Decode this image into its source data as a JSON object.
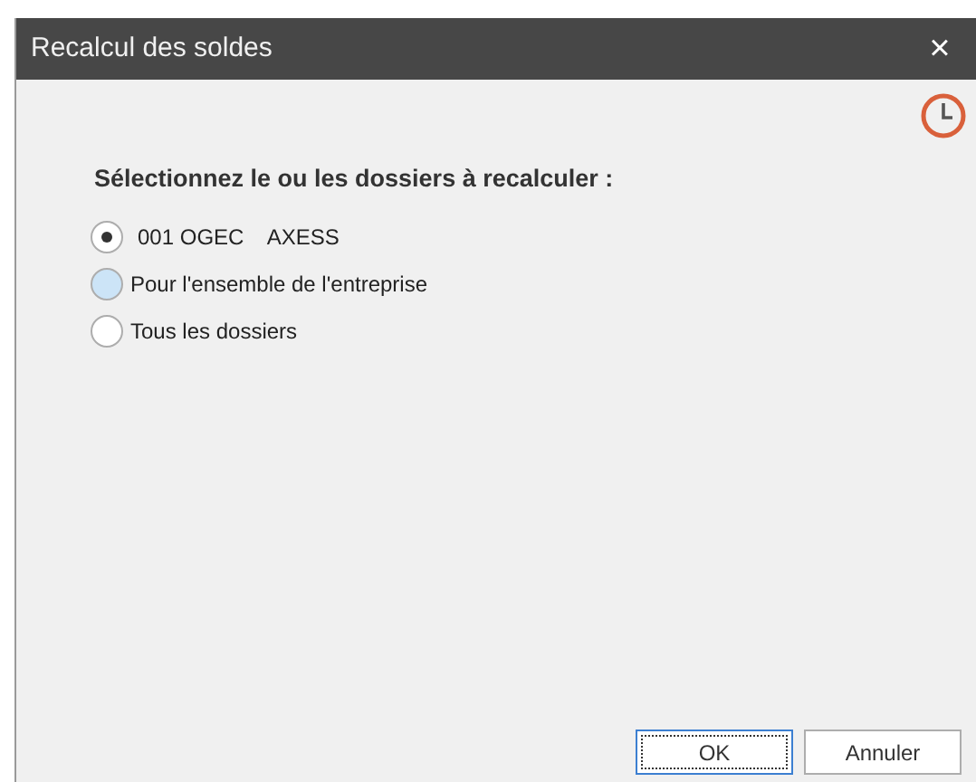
{
  "window": {
    "title": "Recalcul des soldes",
    "close": "×"
  },
  "heading": "Sélectionnez le ou les dossiers à recalculer :",
  "options": [
    {
      "label": "001 OGEC    AXESS",
      "selected": true,
      "hovered": false
    },
    {
      "label": "Pour l'ensemble de l'entreprise",
      "selected": false,
      "hovered": true
    },
    {
      "label": "Tous les dossiers",
      "selected": false,
      "hovered": false
    }
  ],
  "buttons": [
    {
      "label": "OK",
      "focused": true
    },
    {
      "label": "Annuler",
      "focused": false
    }
  ]
}
